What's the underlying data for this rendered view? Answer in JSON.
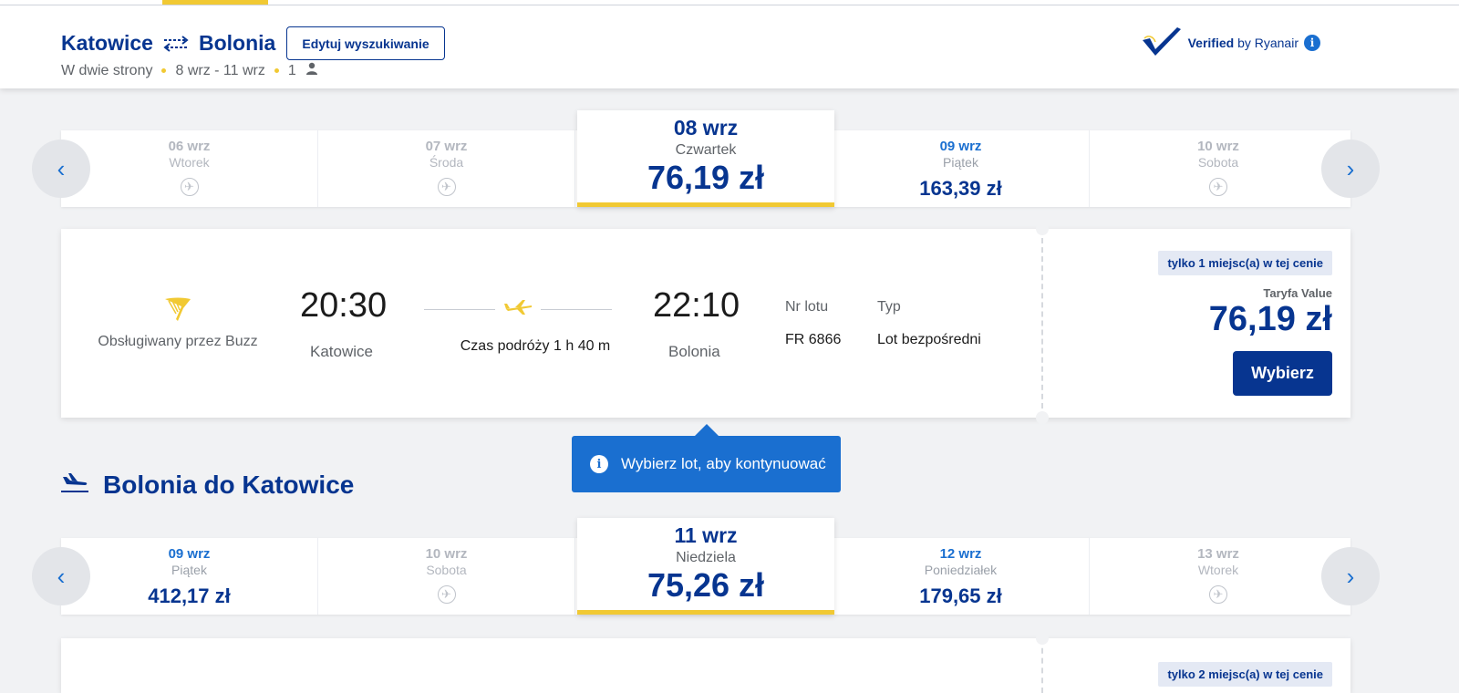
{
  "header": {
    "origin": "Katowice",
    "destination": "Bolonia",
    "edit_button": "Edytuj wyszukiwanie",
    "trip_type": "W dwie strony",
    "dates": "8 wrz - 11 wrz",
    "passengers": "1",
    "verified_strong": "Verified",
    "verified_rest": "by Ryanair"
  },
  "outbound_dates": [
    {
      "date": "06 wrz",
      "weekday": "Wtorek",
      "price": null,
      "available": false
    },
    {
      "date": "07 wrz",
      "weekday": "Środa",
      "price": null,
      "available": false
    },
    {
      "date": "08 wrz",
      "weekday": "Czwartek",
      "price": "76,19 zł",
      "available": true,
      "selected": true
    },
    {
      "date": "09 wrz",
      "weekday": "Piątek",
      "price": "163,39 zł",
      "available": true
    },
    {
      "date": "10 wrz",
      "weekday": "Sobota",
      "price": null,
      "available": false
    }
  ],
  "flight": {
    "operator": "Obsługiwany przez Buzz",
    "depart_time": "20:30",
    "depart_city": "Katowice",
    "duration": "Czas podróży 1 h 40 m",
    "arrive_time": "22:10",
    "arrive_city": "Bolonia",
    "flight_no_label": "Nr lotu",
    "flight_no": "FR 6866",
    "type_label": "Typ",
    "type": "Lot bezpośredni",
    "seats_left": "tylko 1 miejsc(a) w tej cenie",
    "fare_name": "Taryfa Value",
    "price": "76,19 zł",
    "select_label": "Wybierz"
  },
  "tooltip": {
    "text": "Wybierz lot, aby kontynuować"
  },
  "return_section": {
    "title": "Bolonia do Katowice"
  },
  "return_dates": [
    {
      "date": "09 wrz",
      "weekday": "Piątek",
      "price": "412,17 zł",
      "available": true
    },
    {
      "date": "10 wrz",
      "weekday": "Sobota",
      "price": null,
      "available": false
    },
    {
      "date": "11 wrz",
      "weekday": "Niedziela",
      "price": "75,26 zł",
      "available": true,
      "selected": true
    },
    {
      "date": "12 wrz",
      "weekday": "Poniedziałek",
      "price": "179,65 zł",
      "available": true
    },
    {
      "date": "13 wrz",
      "weekday": "Wtorek",
      "price": null,
      "available": false
    }
  ],
  "return_card": {
    "seats_left": "tylko 2 miejsc(a) w tej cenie"
  },
  "colors": {
    "brand_blue": "#073590",
    "accent_yellow": "#f1c933",
    "link_blue": "#1a6fd0"
  }
}
